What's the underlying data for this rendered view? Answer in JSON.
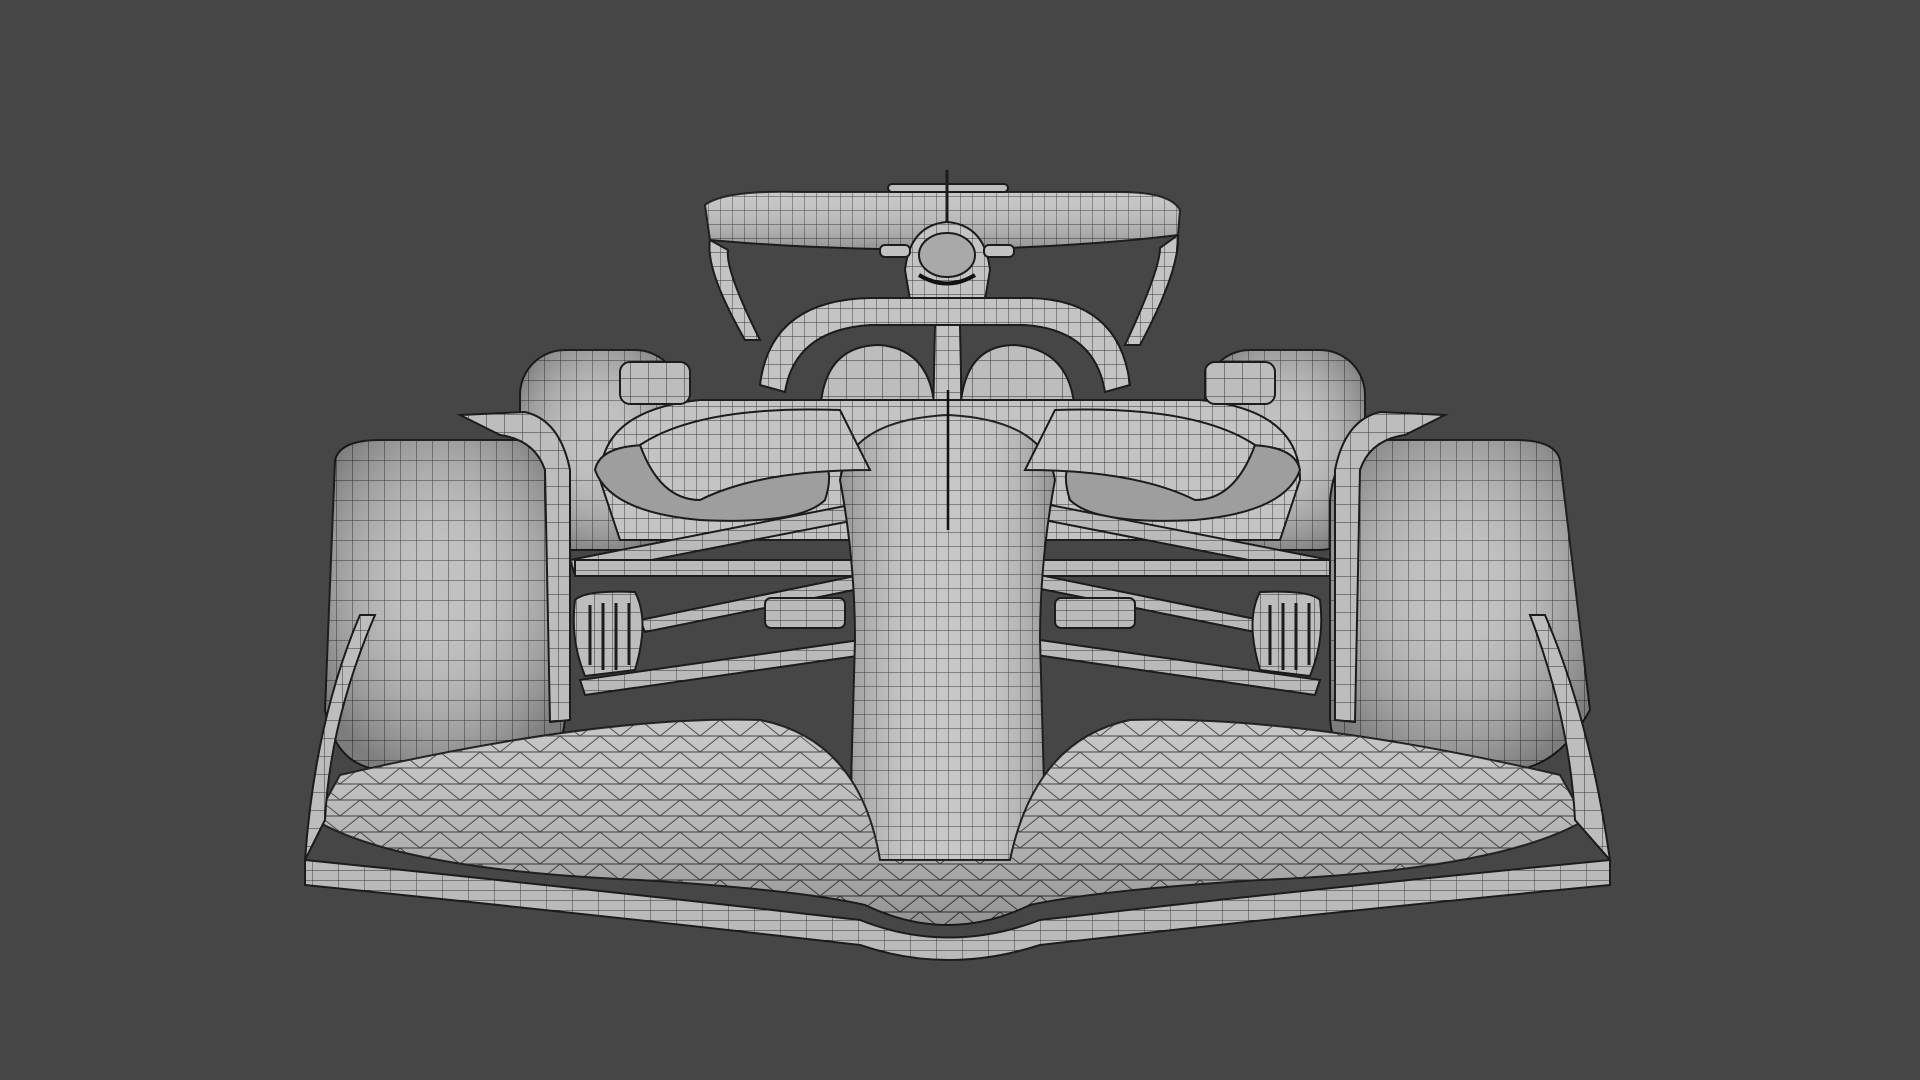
{
  "viewport": {
    "background": "#464646",
    "model_name": "formula-car",
    "shading": "solid-with-wireframe",
    "view": "front",
    "colors": {
      "surface": "#b9b9b9",
      "surface_light": "#cfcfcf",
      "surface_dark": "#8e8e8e",
      "wire": "#2e2e2e",
      "outline": "#1c1c1c"
    }
  }
}
